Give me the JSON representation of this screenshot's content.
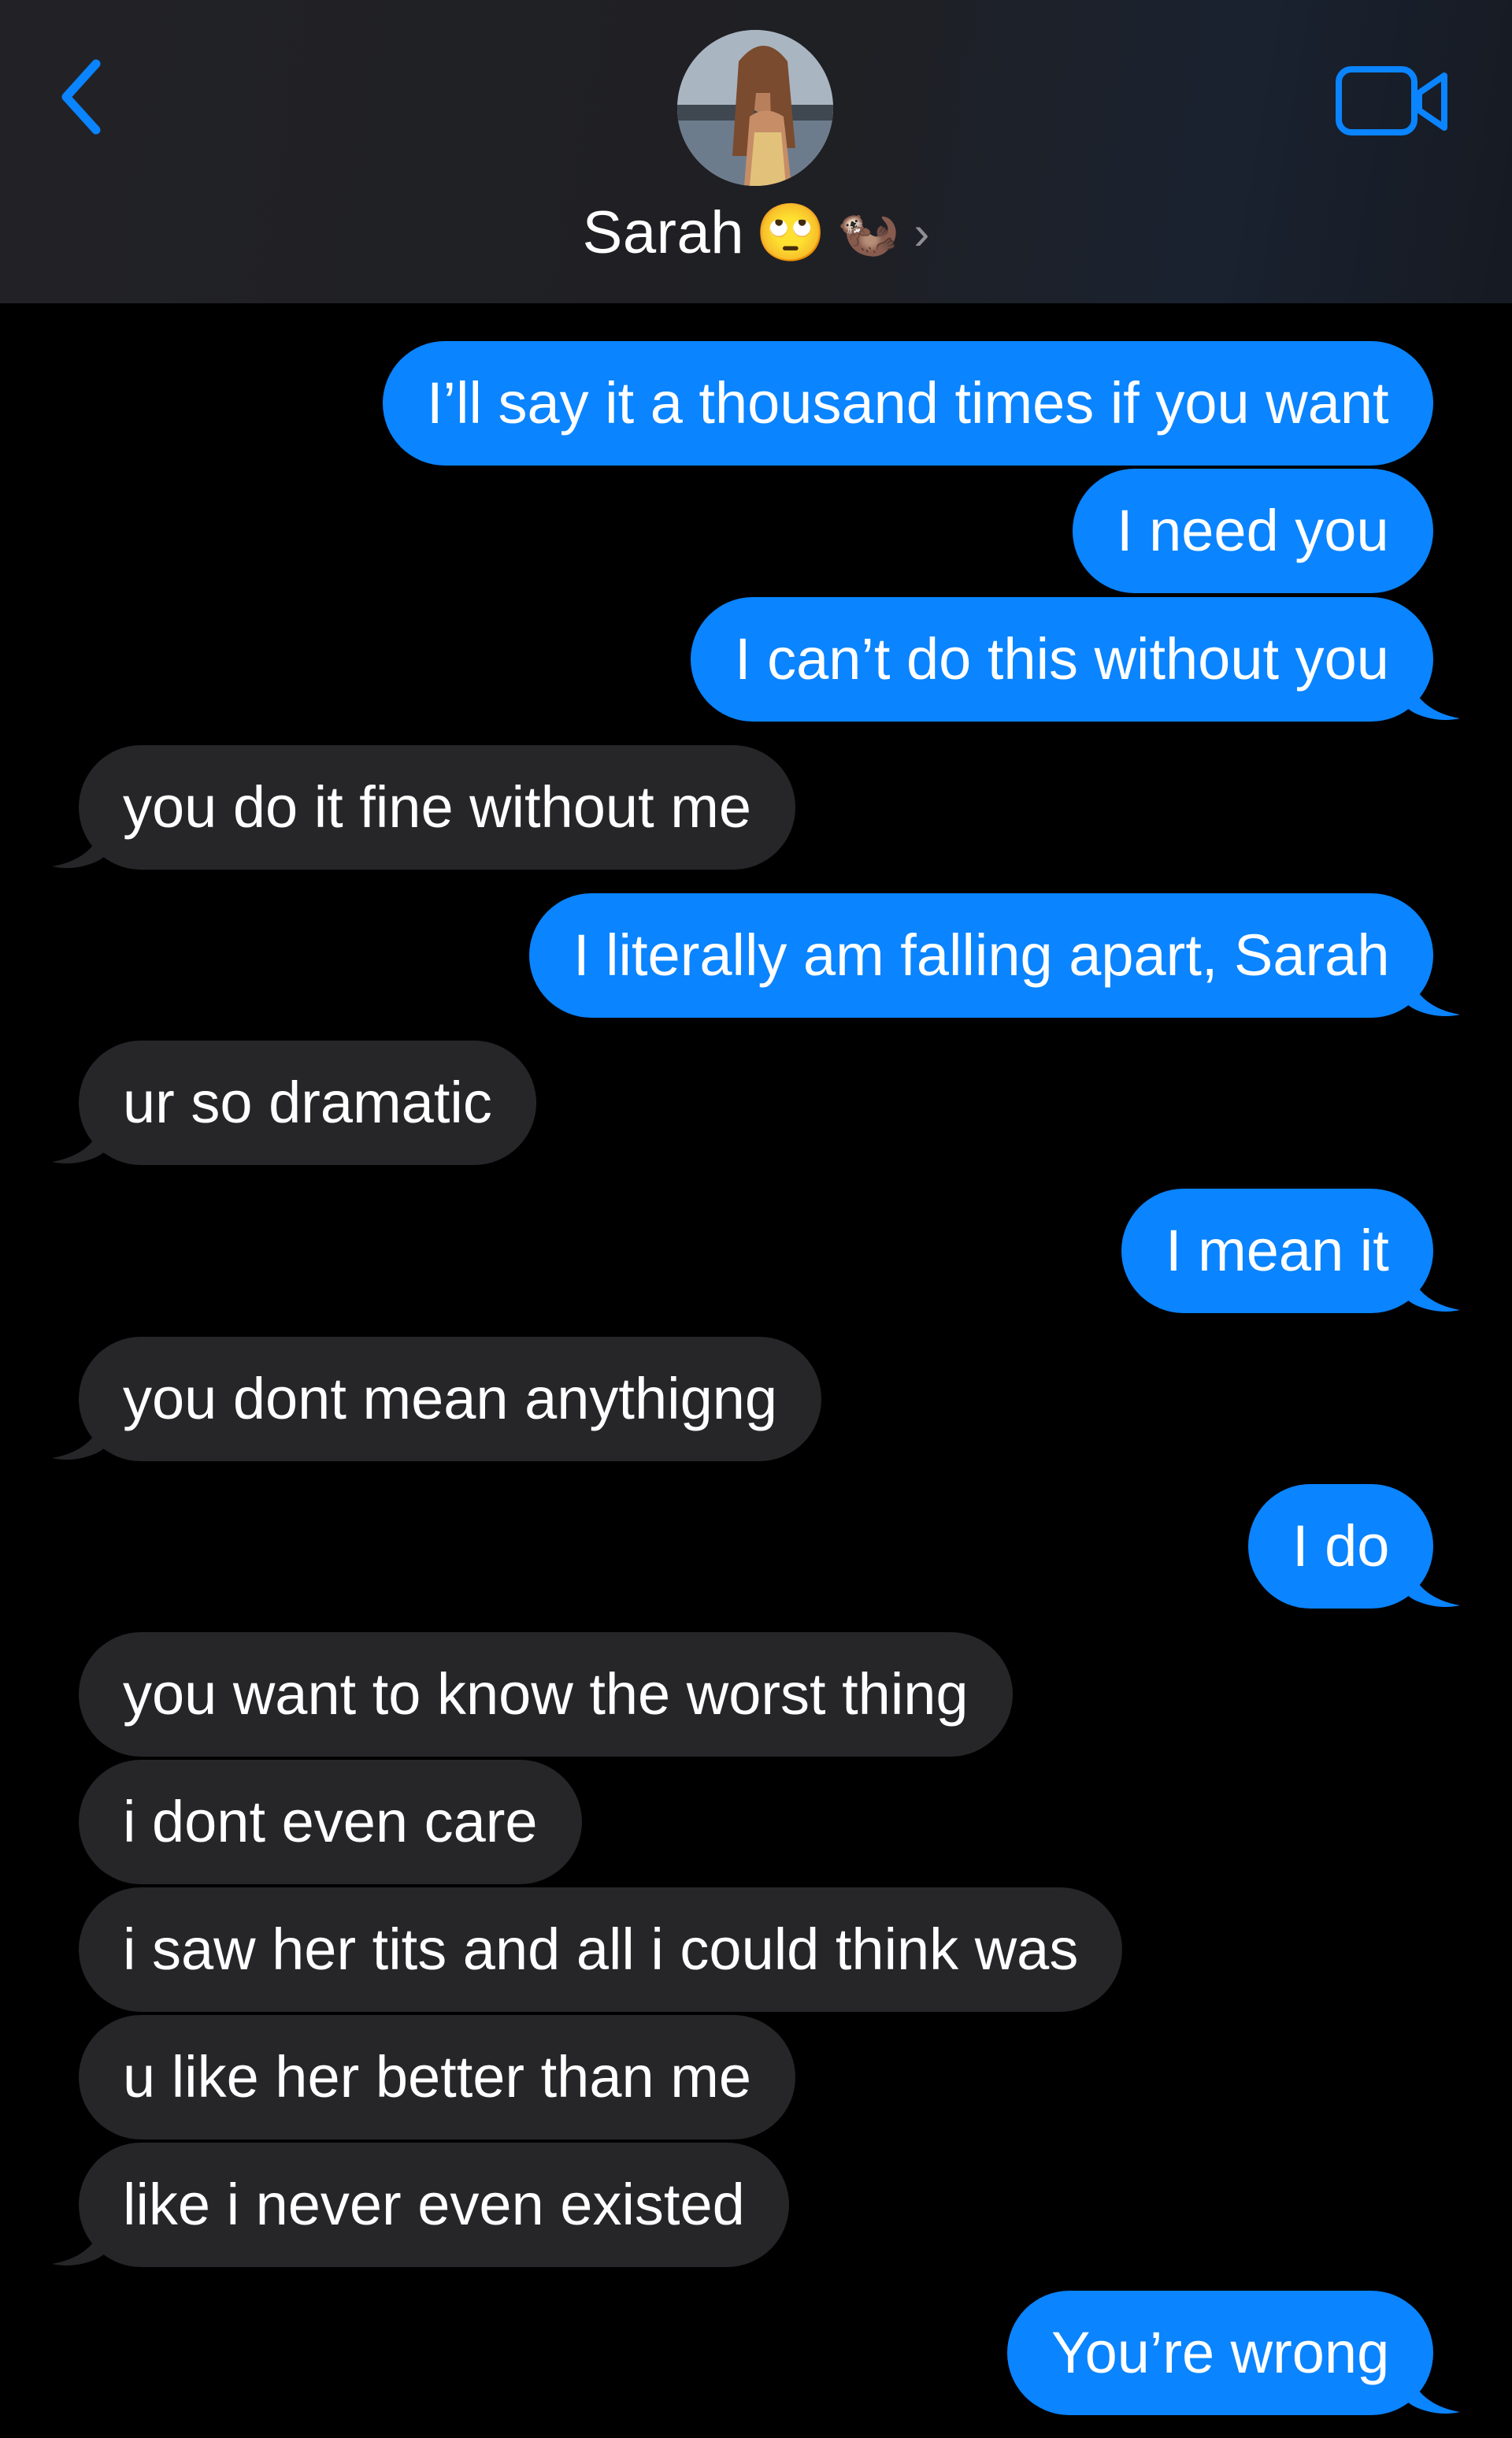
{
  "header": {
    "contact_name": "Sarah",
    "emojis": [
      "face-with-rolling-eyes-icon",
      "otter-icon"
    ],
    "accent_color": "#0a84ff"
  },
  "messages": [
    {
      "from": "me",
      "text": "I’ll say it a thousand times if you want"
    },
    {
      "from": "me",
      "text": "I need you"
    },
    {
      "from": "me",
      "text": "I can’t do this without you"
    },
    {
      "from": "them",
      "text": "you do it fine without me"
    },
    {
      "from": "me",
      "text": "I literally am falling apart, Sarah"
    },
    {
      "from": "them",
      "text": "ur so dramatic"
    },
    {
      "from": "me",
      "text": "I mean it"
    },
    {
      "from": "them",
      "text": "you dont mean anythigng"
    },
    {
      "from": "me",
      "text": "I do"
    },
    {
      "from": "them",
      "text": "you want to know the worst thing"
    },
    {
      "from": "them",
      "text": "i dont even care"
    },
    {
      "from": "them",
      "text": "i saw her tits and all i could think was"
    },
    {
      "from": "them",
      "text": "u like her better than me"
    },
    {
      "from": "them",
      "text": "like i never even existed"
    },
    {
      "from": "me",
      "text": "You’re wrong"
    }
  ],
  "colors": {
    "outgoing_bubble": "#0a84ff",
    "incoming_bubble": "#262629",
    "background": "#000000"
  }
}
